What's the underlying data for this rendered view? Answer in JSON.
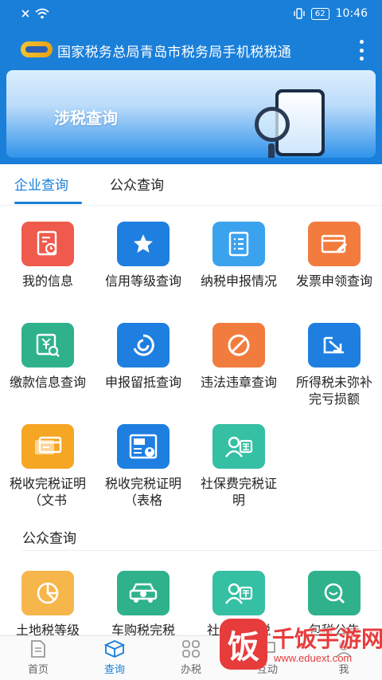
{
  "status_bar": {
    "signal_text": "✕",
    "battery": "62",
    "time": "10:46"
  },
  "header": {
    "title": "国家税务总局青岛市税务局手机税税通"
  },
  "banner": {
    "title": "涉税查询"
  },
  "tabs": [
    {
      "label": "企业查询"
    },
    {
      "label": "公众查询"
    }
  ],
  "grid_items": [
    {
      "label": "我的信息",
      "icon": "document-clock-icon",
      "color": "#ef5a4c"
    },
    {
      "label": "信用等级查询",
      "icon": "star-icon",
      "color": "#1e7fe0"
    },
    {
      "label": "纳税申报情况",
      "icon": "form-icon",
      "color": "#3ba2ee"
    },
    {
      "label": "发票申领查询",
      "icon": "invoice-pen-icon",
      "color": "#f27c3d"
    },
    {
      "label": "缴款信息查询",
      "icon": "yuan-search-icon",
      "color": "#2fb28b"
    },
    {
      "label": "申报留抵查询",
      "icon": "cycle-icon",
      "color": "#1e7fe0"
    },
    {
      "label": "违法违章查询",
      "icon": "prohibited-icon",
      "color": "#f27c3d"
    },
    {
      "label": "所得税未弥补完亏损额",
      "icon": "arrow-down-right-icon",
      "color": "#1e7fe0"
    },
    {
      "label": "税收完税证明（文书",
      "icon": "card-icon",
      "color": "#f5a623"
    },
    {
      "label": "税收完税证明（表格",
      "icon": "certificate-person-icon",
      "color": "#1e7fe0"
    },
    {
      "label": "社保费完税证明",
      "icon": "social-insurance-icon",
      "color": "#35bfa3"
    }
  ],
  "section2": {
    "title": "公众查询"
  },
  "public_items": [
    {
      "label": "土地税等级",
      "icon": "pie-chart-icon",
      "color": "#f6b64c"
    },
    {
      "label": "车购税完税",
      "icon": "car-tax-icon",
      "color": "#2fb28b"
    },
    {
      "label": "社保费完税",
      "icon": "social-insurance-icon",
      "color": "#35bfa3"
    },
    {
      "label": "包税公告",
      "icon": "search-chat-icon",
      "color": "#2fb28b"
    }
  ],
  "bottom_nav": [
    {
      "label": "首页",
      "icon": "home-doc-icon"
    },
    {
      "label": "查询",
      "icon": "box-icon"
    },
    {
      "label": "办税",
      "icon": "grid-icon"
    },
    {
      "label": "互动",
      "icon": "chat-icon"
    },
    {
      "label": "我",
      "icon": "user-icon"
    }
  ],
  "watermark": {
    "badge": "饭",
    "title": "千饭手游网",
    "url": "www.eduext.com"
  }
}
